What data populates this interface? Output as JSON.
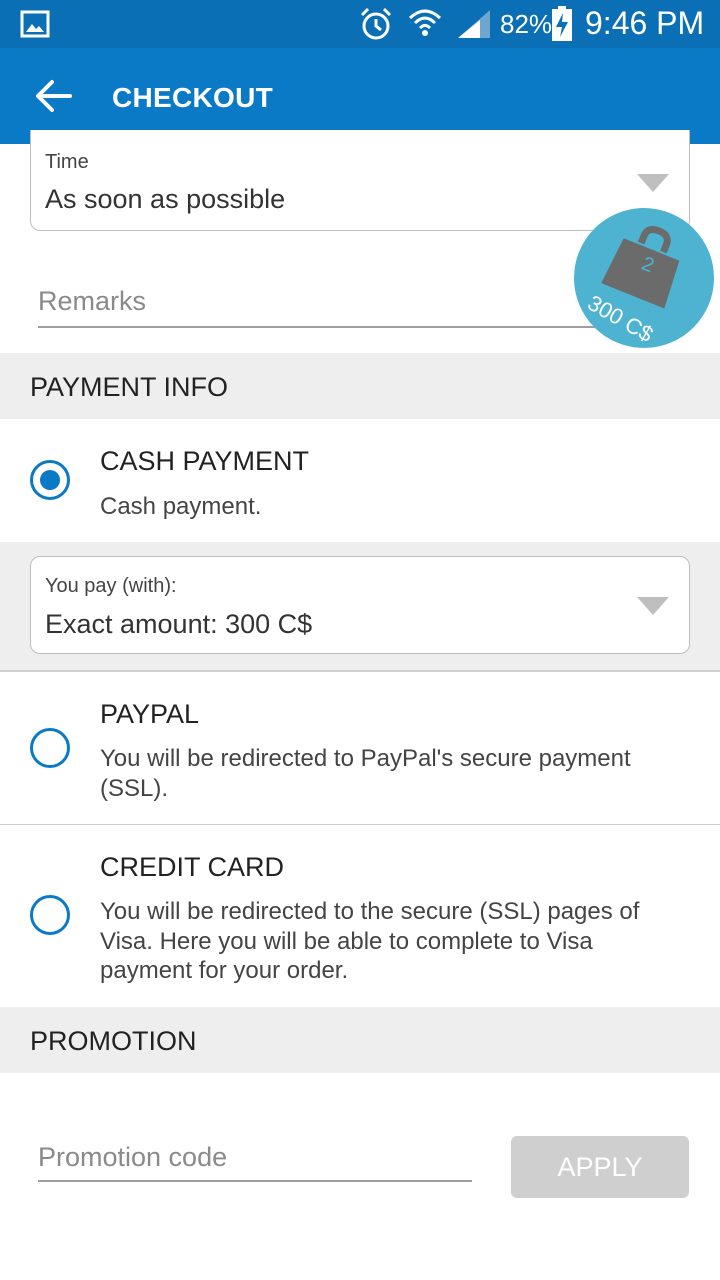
{
  "status_bar": {
    "battery_percent": "82%",
    "time": "9:46 PM",
    "icons": [
      "gallery-icon",
      "alarm-icon",
      "wifi-icon",
      "signal-icon",
      "battery-charging-icon"
    ]
  },
  "app_bar": {
    "title": "CHECKOUT",
    "back_icon": "arrow-back-icon"
  },
  "time_field": {
    "label": "Time",
    "value": "As soon as possible"
  },
  "remarks": {
    "placeholder": "Remarks"
  },
  "cart_badge": {
    "count": "2",
    "amount": "300 C$"
  },
  "payment_info": {
    "header": "PAYMENT INFO",
    "options": [
      {
        "name": "CASH PAYMENT",
        "description": "Cash payment.",
        "selected": true
      },
      {
        "name": "PAYPAL",
        "description": "You will be redirected to PayPal's secure payment (SSL).",
        "selected": false
      },
      {
        "name": "CREDIT CARD",
        "description": "You will be redirected to the secure (SSL) pages of Visa. Here you will be able to complete to Visa payment for your order.",
        "selected": false
      }
    ],
    "you_pay": {
      "label": "You pay (with):",
      "value": "Exact amount: 300 C$"
    }
  },
  "promotion": {
    "header": "PROMOTION",
    "placeholder": "Promotion code",
    "apply_label": "APPLY"
  },
  "colors": {
    "status_bar": "#0a6fb4",
    "app_bar": "#0a79c6",
    "accent": "#0a79c6",
    "cart_badge": "#4db3d0",
    "section_bg": "#eeeeee",
    "apply_disabled": "#cfcfcf"
  }
}
